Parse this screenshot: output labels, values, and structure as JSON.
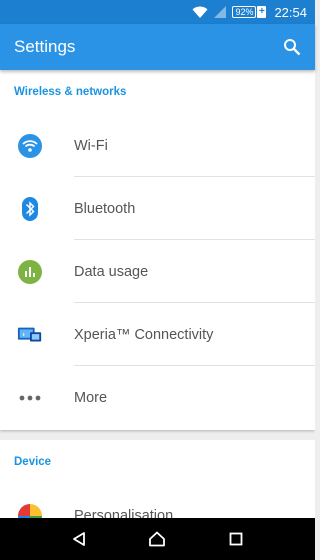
{
  "status_bar": {
    "battery_percent": "92%",
    "battery_plus": "+",
    "time": "22:54",
    "icons": [
      "wifi-icon",
      "cell-signal-icon",
      "battery-icon"
    ]
  },
  "app_bar": {
    "title": "Settings",
    "search_icon": "search-icon"
  },
  "sections": {
    "wireless": {
      "header": "Wireless & networks",
      "items": [
        {
          "label": "Wi-Fi",
          "icon": "wifi-icon",
          "color": "#2b93e6"
        },
        {
          "label": "Bluetooth",
          "icon": "bluetooth-icon",
          "color": "#1e88e5"
        },
        {
          "label": "Data usage",
          "icon": "data-usage-icon",
          "color": "#7cb342"
        },
        {
          "label": "Xperia™ Connectivity",
          "icon": "screen-mirroring-icon",
          "color": "#2196f3"
        },
        {
          "label": "More",
          "icon": "more-dots-icon",
          "color": "#666666"
        }
      ]
    },
    "device": {
      "header": "Device",
      "items": [
        {
          "label": "Personalisation",
          "icon": "personalisation-icon"
        }
      ]
    }
  },
  "nav_bar": {
    "buttons": [
      "back-icon",
      "home-icon",
      "recents-icon"
    ]
  }
}
